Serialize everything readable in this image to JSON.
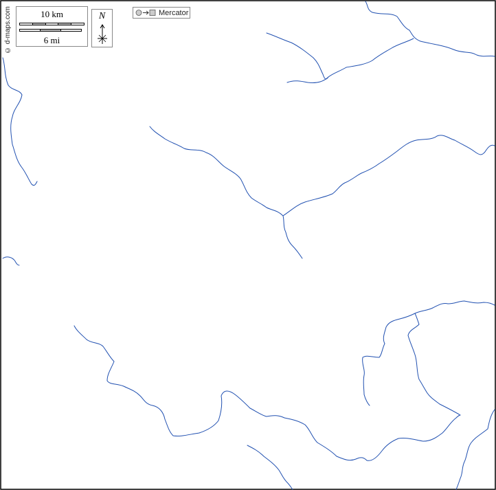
{
  "map": {
    "projection": "Mercator",
    "credit": "© d-maps.com",
    "water_color": "#1f4fb0",
    "frame_color": "#000000",
    "background_color": "#ffffff"
  },
  "scale": {
    "km_label": "10 km",
    "mi_label": "6 mi"
  },
  "north": {
    "letter": "N"
  },
  "icons": {
    "projection": "circle-arrow-square-icon",
    "north": "compass-rose-icon"
  }
}
